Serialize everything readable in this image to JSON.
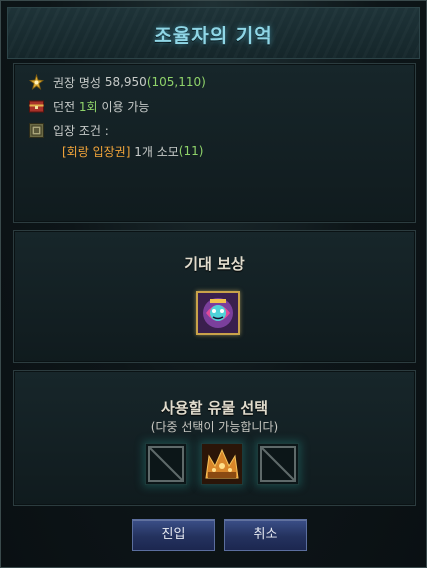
{
  "window": {
    "title": "조율자의 기억"
  },
  "info": {
    "reputation_label": "권장 명성",
    "reputation_value": "58,950",
    "reputation_extra": "(105,110)",
    "dungeon_prefix": "던전",
    "dungeon_count": "1회",
    "dungeon_suffix": "이용 가능",
    "entry_label": "입장 조건 :",
    "ticket_name": "[회랑 입장권]",
    "ticket_consume": "1개 소모",
    "ticket_owned": "(11)"
  },
  "reward": {
    "title": "기대 보상"
  },
  "relic": {
    "title": "사용할 유물 선택",
    "subtitle": "(다중 선택이 가능합니다)"
  },
  "buttons": {
    "enter": "진입",
    "cancel": "취소"
  },
  "colors": {
    "title": "#8fd6e6",
    "gold": "#e6c15a",
    "green": "#8fd36a",
    "orange": "#f3a53a",
    "button": "#2a3a6e"
  },
  "icons": [
    "reputation-icon",
    "dungeon-chest-icon",
    "entry-ticket-icon",
    "reward-item-icon",
    "empty-slot-icon",
    "relic-crown-icon"
  ]
}
